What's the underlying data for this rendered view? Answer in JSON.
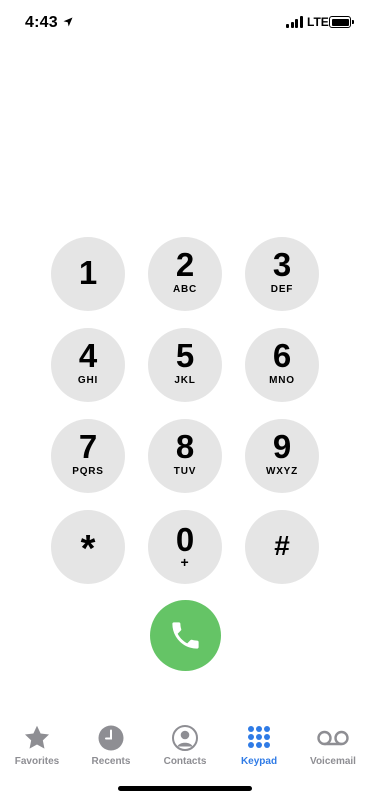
{
  "status": {
    "time": "4:43",
    "network": "LTE"
  },
  "keypad": [
    {
      "digit": "1",
      "letters": ""
    },
    {
      "digit": "2",
      "letters": "ABC"
    },
    {
      "digit": "3",
      "letters": "DEF"
    },
    {
      "digit": "4",
      "letters": "GHI"
    },
    {
      "digit": "5",
      "letters": "JKL"
    },
    {
      "digit": "6",
      "letters": "MNO"
    },
    {
      "digit": "7",
      "letters": "PQRS"
    },
    {
      "digit": "8",
      "letters": "TUV"
    },
    {
      "digit": "9",
      "letters": "WXYZ"
    },
    {
      "digit": "*",
      "letters": ""
    },
    {
      "digit": "0",
      "letters": "+"
    },
    {
      "digit": "#",
      "letters": ""
    }
  ],
  "call_button": {
    "icon": "phone-icon",
    "color": "#65c466"
  },
  "tabs": [
    {
      "label": "Favorites",
      "icon": "star-icon",
      "active": false
    },
    {
      "label": "Recents",
      "icon": "clock-icon",
      "active": false
    },
    {
      "label": "Contacts",
      "icon": "contact-icon",
      "active": false
    },
    {
      "label": "Keypad",
      "icon": "keypad-grid-icon",
      "active": true
    },
    {
      "label": "Voicemail",
      "icon": "voicemail-icon",
      "active": false
    }
  ],
  "colors": {
    "active_tab": "#2f7be6",
    "inactive_tab": "#8e8e93",
    "key_bg": "#e5e5e5"
  }
}
